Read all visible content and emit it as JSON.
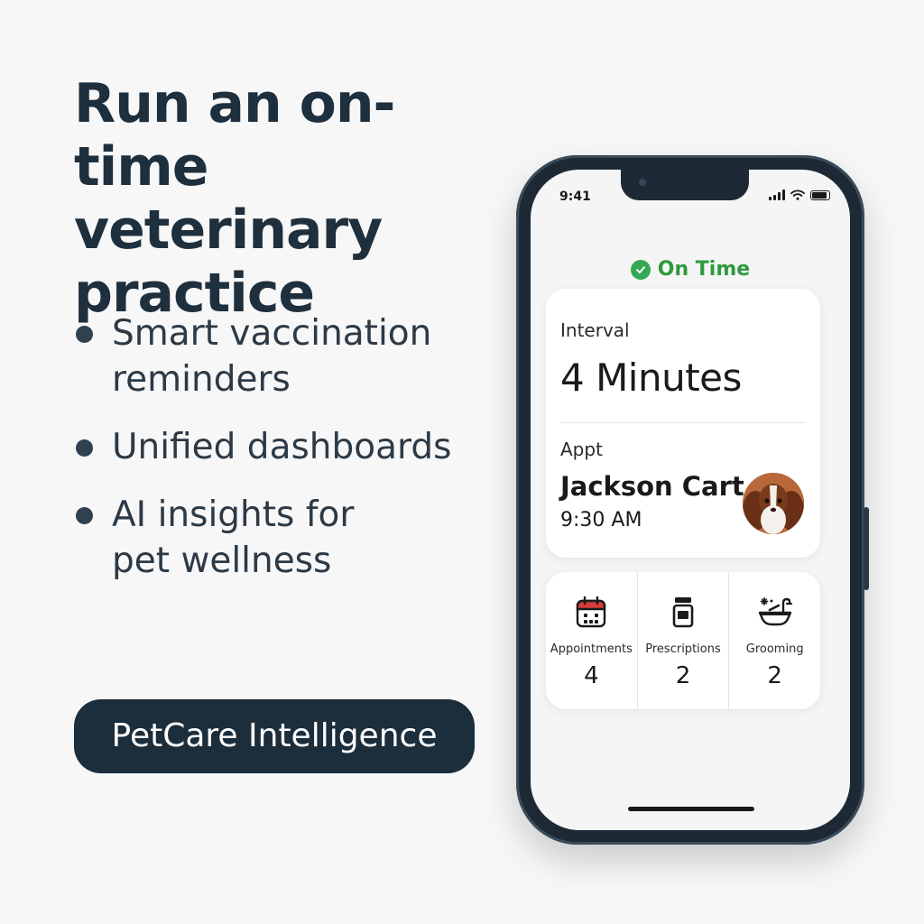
{
  "headline": {
    "line1": "Run an on-time",
    "line2": "veterinary",
    "line3": "practice"
  },
  "features": [
    {
      "line1": "Smart vaccination",
      "line2": "reminders"
    },
    {
      "line1": "Unified dashboards",
      "line2": ""
    },
    {
      "line1": "AI insights for",
      "line2": "pet wellness"
    }
  ],
  "brand_button": "PetCare Intelligence",
  "phone": {
    "status_time": "9:41",
    "status": "On Time",
    "interval_label": "Interval",
    "interval_value": "4 Minutes",
    "appt_label": "Appt",
    "appt_name": "Jackson Cart",
    "appt_time": "9:30 AM",
    "stats": [
      {
        "label": "Appointments",
        "value": "4",
        "icon": "calendar-icon"
      },
      {
        "label": "Prescriptions",
        "value": "2",
        "icon": "pill-bottle-icon"
      },
      {
        "label": "Grooming",
        "value": "2",
        "icon": "grooming-bath-icon"
      }
    ]
  },
  "colors": {
    "headline": "#1e2f3e",
    "pill_bg": "#1c2d3b",
    "on_time_green": "#2e9a3e",
    "phone_body": "#1d2a36",
    "calendar_red": "#d93a3a"
  }
}
